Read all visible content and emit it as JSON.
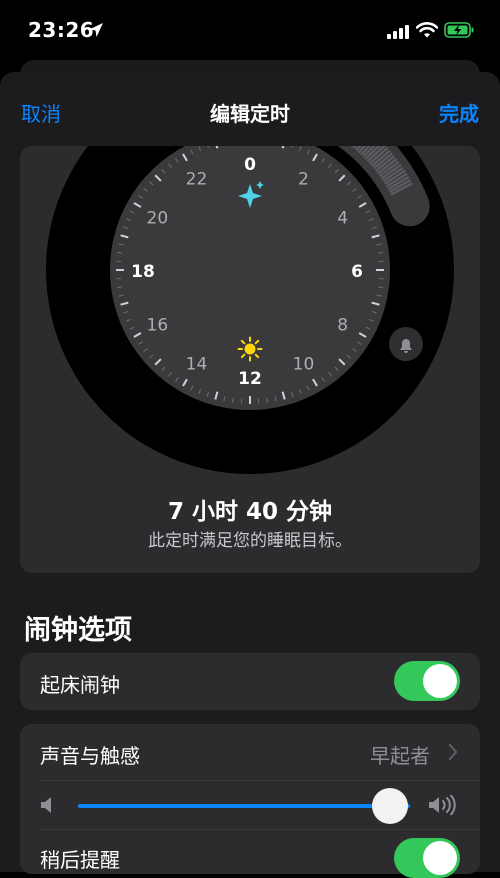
{
  "status": {
    "time": "23:26"
  },
  "nav": {
    "cancel": "取消",
    "title": "编辑定时",
    "done": "完成"
  },
  "clock": {
    "hour_labels": [
      "0",
      "2",
      "4",
      "6",
      "8",
      "10",
      "12",
      "14",
      "16",
      "18",
      "20",
      "22"
    ],
    "duration": "7 小时 40 分钟",
    "goal_message": "此定时满足您的睡眠目标。"
  },
  "alarm_options": {
    "section_title": "闹钟选项",
    "wake_up_alarm": {
      "label": "起床闹钟",
      "on": true
    },
    "sounds": {
      "label": "声音与触感",
      "value": "早起者",
      "volume": 0.94
    },
    "snooze": {
      "label": "稍后提醒",
      "on": true
    }
  },
  "colors": {
    "accent": "#0a84ff",
    "toggle_on": "#34c759",
    "bedtime_icon": "#4fd1e8",
    "wake_icon": "#ffd60a"
  }
}
